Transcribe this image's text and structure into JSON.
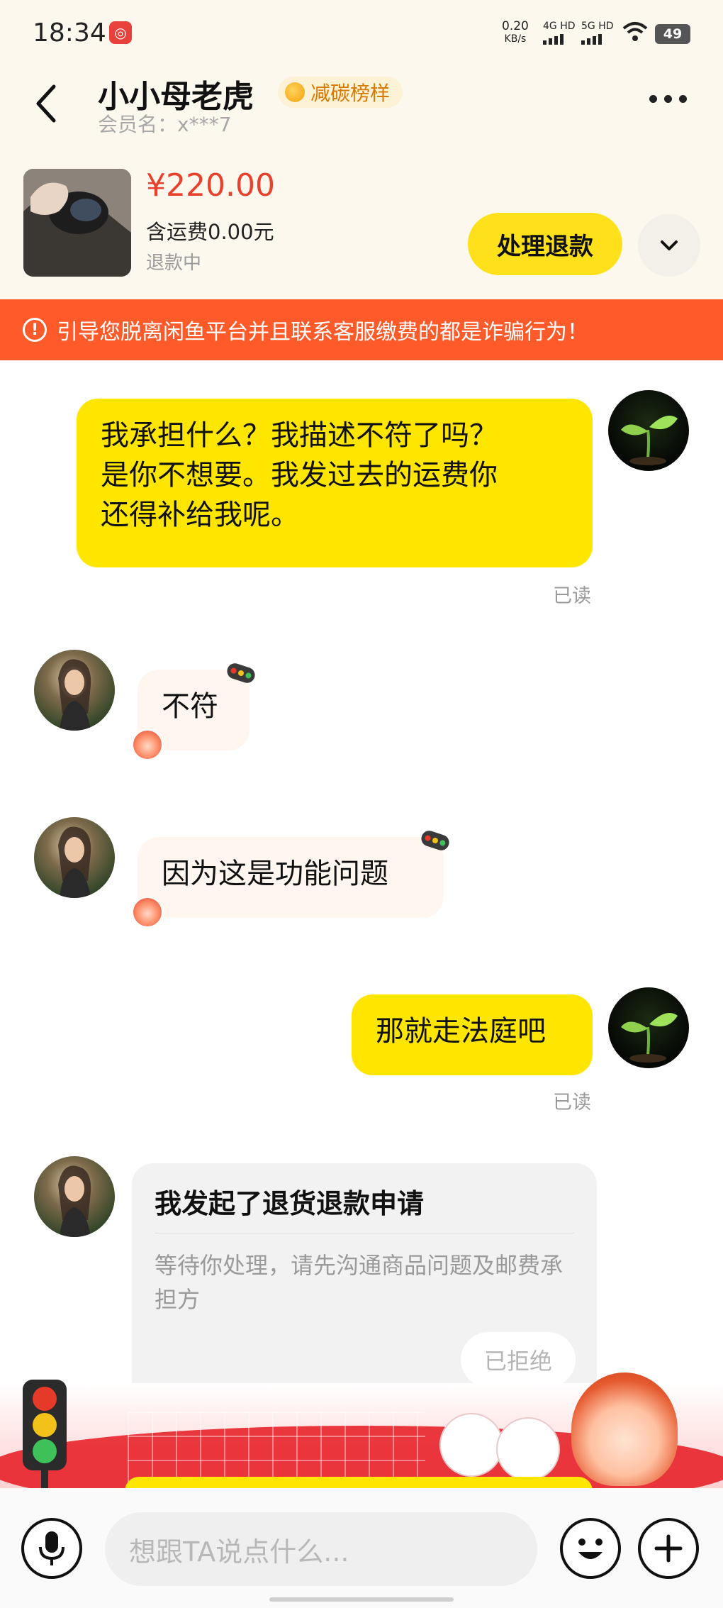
{
  "status_bar": {
    "time": "18:34",
    "net_speed": "0.20",
    "net_speed_unit": "KB/s",
    "sim1": "4G HD",
    "sim2": "5G HD",
    "battery": "49"
  },
  "header": {
    "user_name": "小小母老虎",
    "badge_label": "减碳榜样",
    "member_name": "会员名：x***7"
  },
  "product": {
    "price": "¥220.00",
    "shipping": "含运费0.00元",
    "status": "退款中",
    "refund_button_label": "处理退款"
  },
  "warning": {
    "text": "引导您脱离闲鱼平台并且联系客服缴费的都是诈骗行为！"
  },
  "messages": [
    {
      "sender": "self",
      "lines": [
        "我承担什么？我描述不符了吗？",
        "是你不想要。我发过去的运费你",
        "还得补给我呢。"
      ],
      "read": "已读"
    },
    {
      "sender": "other",
      "text": "不符"
    },
    {
      "sender": "other",
      "text": "因为这是功能问题"
    },
    {
      "sender": "self",
      "text": "那就走法庭吧",
      "read": "已读"
    }
  ],
  "refund_card": {
    "title": "我发起了退货退款申请",
    "description": "等待你处理，请先沟通商品问题及邮费承担方",
    "status": "已拒绝"
  },
  "input": {
    "placeholder": "想跟TA说点什么..."
  },
  "colors": {
    "self_bubble": "#ffe600",
    "warning_banner": "#ff5a2a",
    "price": "#e8412d",
    "refund_button": "#ffe11b"
  }
}
